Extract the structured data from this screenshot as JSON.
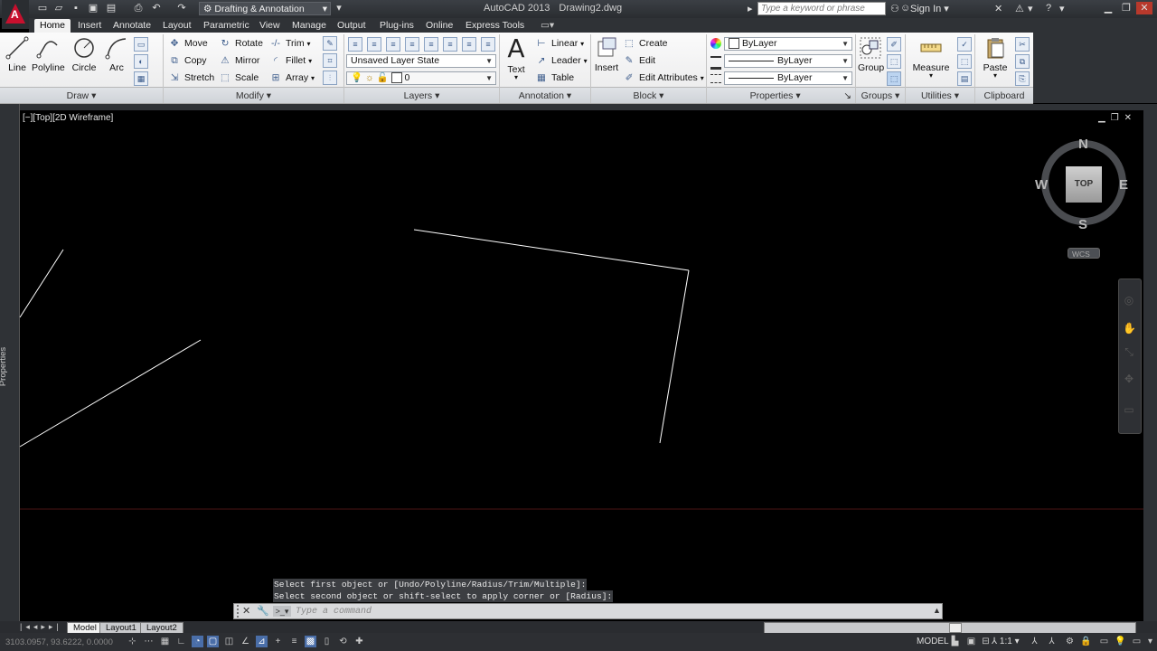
{
  "app": {
    "title": "AutoCAD 2013",
    "file": "Drawing2.dwg",
    "logo_letter": "A",
    "workspace": "Drafting & Annotation",
    "search_placeholder": "Type a keyword or phrase",
    "signin": "Sign In"
  },
  "tabs": [
    "Home",
    "Insert",
    "Annotate",
    "Layout",
    "Parametric",
    "View",
    "Manage",
    "Output",
    "Plug-ins",
    "Online",
    "Express Tools"
  ],
  "ribbon": {
    "draw": {
      "title": "Draw",
      "line": "Line",
      "polyline": "Polyline",
      "circle": "Circle",
      "arc": "Arc"
    },
    "modify": {
      "title": "Modify",
      "move": "Move",
      "rotate": "Rotate",
      "trim": "Trim",
      "copy": "Copy",
      "mirror": "Mirror",
      "fillet": "Fillet",
      "stretch": "Stretch",
      "scale": "Scale",
      "array": "Array"
    },
    "layers": {
      "title": "Layers",
      "layer_state": "Unsaved Layer State",
      "current_layer": "0"
    },
    "annotation": {
      "title": "Annotation",
      "text": "Text",
      "linear": "Linear",
      "leader": "Leader",
      "table": "Table"
    },
    "block": {
      "title": "Block",
      "insert": "Insert",
      "create": "Create",
      "edit": "Edit",
      "edit_attributes": "Edit Attributes"
    },
    "properties": {
      "title": "Properties",
      "color": "ByLayer",
      "linetype": "ByLayer",
      "lineweight": "ByLayer"
    },
    "groups": {
      "title": "Groups",
      "group": "Group"
    },
    "utilities": {
      "title": "Utilities",
      "measure": "Measure"
    },
    "clipboard": {
      "title": "Clipboard",
      "paste": "Paste"
    }
  },
  "viewport": {
    "label": "[−][Top][2D Wireframe]",
    "sidebar_label": "Properties",
    "compass": {
      "n": "N",
      "s": "S",
      "e": "E",
      "w": "W",
      "face": "TOP",
      "ucs": "WCS"
    }
  },
  "command": {
    "history": [
      "Select first object or [Undo/Polyline/Radius/Trim/Multiple]:",
      "Select second object or shift-select to apply corner or [Radius]:"
    ],
    "placeholder": "Type a command"
  },
  "layout_tabs": [
    "Model",
    "Layout1",
    "Layout2"
  ],
  "status": {
    "coords": "3103.0957, 93.6222, 0.0000",
    "model": "MODEL",
    "scale": "1:1"
  }
}
